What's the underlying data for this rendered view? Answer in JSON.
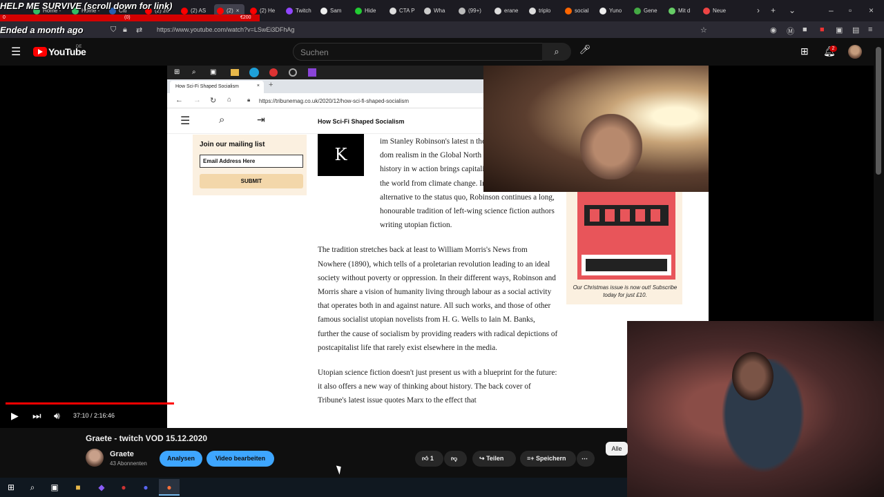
{
  "overlay": {
    "stream_title": "HELP ME SURVIVE (scroll down for link)",
    "ended": "Ended a month ago",
    "goal_left": "0",
    "goal_mid": "(0)",
    "goal_right": "€200"
  },
  "browser": {
    "tabs": [
      "Home - ",
      "Home - ",
      "Citi",
      "(2) zo",
      "(2) AS",
      "(2)",
      "(2) He",
      "Twitch",
      "Sam",
      "Hide",
      "CTA P",
      "Wha",
      "(99+)",
      "erane",
      "triplo",
      "social",
      "Yuno",
      "Gene",
      "Mit d",
      "Neue"
    ],
    "url": "https://www.youtube.com/watch?v=LSwEi3DFhAg"
  },
  "youtube": {
    "logo_text": "YouTube",
    "region": "DE",
    "search_placeholder": "Suchen",
    "notification_count": "2"
  },
  "capture": {
    "tab_title": "How Sci-Fi Shaped Socialism",
    "url": "https://tribunemag.co.uk/2020/12/how-sci-fi-shaped-socialism",
    "site_title": "How Sci-Fi Shaped Socialism",
    "mailing_title": "Join our mailing list",
    "email_placeholder": "Email Address Here",
    "submit_label": "SUBMIT",
    "logo_letter": "K",
    "paragraphs": [
      "im Stanley Robinson's latest n the Future, challenges the dom realism in the Global North b speculative future history in w action brings capitalism to an end and saves the world from climate change. In imagining an alternative to the status quo, Robinson continues a long, honourable tradition of left-wing science fiction authors writing utopian fiction.",
      "The tradition stretches back at least to William Morris's News from Nowhere (1890), which tells of a proletarian revolution leading to an ideal society without poverty or oppression. In their different ways, Robinson and Morris share a vision of humanity living through labour as a social activity that operates both in and against nature. All such works, and those of other famous socialist utopian novelists from H. G. Wells to Iain M. Banks, further the cause of socialism by providing readers with radical depictions of postcapitalist life that rarely exist elsewhere in the media.",
      "Utopian science fiction doesn't just present us with a blueprint for the future: it also offers a new way of thinking about history. The back cover of Tribune's latest issue quotes Marx to the effect that"
    ],
    "magazine_caption": "Our Christmas issue is now out! Subscribe today for just £10."
  },
  "player": {
    "time": "37:10 / 2:16:46",
    "progress_fraction": 0.271
  },
  "video": {
    "title": "Graete - twitch VOD 15.12.2020",
    "channel": "Graete",
    "subscribers": "43 Abonnenten",
    "analytics_label": "Analysen",
    "edit_label": "Video bearbeiten",
    "likes": "1",
    "share_label": "Teilen",
    "save_label": "Speichern",
    "filter_label": "Alle"
  },
  "colors": {
    "yt_red": "#ff0000",
    "accent_blue": "#3ea6ff",
    "bg": "#0f0f0f"
  }
}
